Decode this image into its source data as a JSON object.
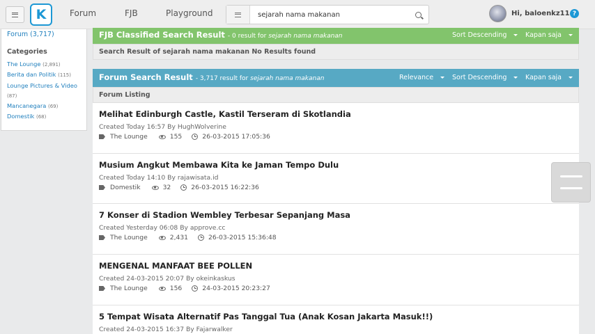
{
  "header": {
    "logo_text": "K",
    "nav": [
      "Forum",
      "FJB",
      "Playground"
    ],
    "search_value": "sejarah nama makanan",
    "greeting": "Hi, baloenkz11",
    "help_label": "?"
  },
  "sidebar": {
    "forum_count": "Forum (3,717)",
    "categories_heading": "Categories",
    "categories": [
      {
        "name": "The Lounge",
        "count": "(2,891)"
      },
      {
        "name": "Berita dan Politik",
        "count": "(115)"
      },
      {
        "name": "Lounge Pictures & Video",
        "count": "(87)"
      },
      {
        "name": "Mancanegara",
        "count": "(69)"
      },
      {
        "name": "Domestik",
        "count": "(68)"
      }
    ]
  },
  "fjb_panel": {
    "title": "FJB Classified Search Result",
    "meta_prefix": "- 0 result for",
    "query": "sejarah nama makanan",
    "sort_label": "Sort Descending",
    "time_label": "Kapan saja",
    "no_results": "Search Result of sejarah nama makanan No Results found"
  },
  "forum_panel": {
    "title": "Forum Search Result",
    "meta_prefix": "- 3,717 result for",
    "query": "sejarah nama makanan",
    "relevance_label": "Relevance",
    "sort_label": "Sort Descending",
    "time_label": "Kapan saja",
    "listing_label": "Forum Listing"
  },
  "results": [
    {
      "title": "Melihat Edinburgh Castle, Kastil Terseram di Skotlandia",
      "created": "Created Today 16:57 By",
      "author": "HughWolverine",
      "category": "The Lounge",
      "views": "155",
      "date": "26-03-2015 17:05:36"
    },
    {
      "title": "Musium Angkut Membawa Kita ke Jaman Tempo Dulu",
      "created": "Created Today 14:10 By",
      "author": "rajawisata.id",
      "category": "Domestik",
      "views": "32",
      "date": "26-03-2015 16:22:36"
    },
    {
      "title": "7 Konser di Stadion Wembley Terbesar Sepanjang Masa",
      "created": "Created Yesterday 06:08 By",
      "author": "approve.cc",
      "category": "The Lounge",
      "views": "2,431",
      "date": "26-03-2015 15:36:48"
    },
    {
      "title": "MENGENAL MANFAAT BEE POLLEN",
      "created": "Created 24-03-2015 20:07 By",
      "author": "okeinkaskus",
      "category": "The Lounge",
      "views": "156",
      "date": "24-03-2015 20:23:27"
    },
    {
      "title": "5 Tempat Wisata Alternatif Pas Tanggal Tua (Anak Kosan Jakarta Masuk!!)",
      "created": "Created 24-03-2015 16:37 By",
      "author": "Fajarwalker",
      "category": "",
      "views": "",
      "date": ""
    }
  ]
}
